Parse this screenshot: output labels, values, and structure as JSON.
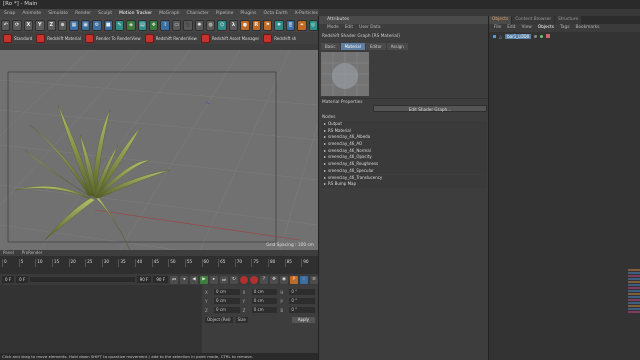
{
  "window": {
    "title": "[Ro *] - Main"
  },
  "menubar": {
    "items": [
      "Snap",
      "Animate",
      "Simulate",
      "Render",
      "Sculpt",
      "Motion Tracker",
      "MoGraph",
      "Character",
      "Pipeline",
      "Plugins",
      "Octa Earth",
      "X-Particles",
      "Redshift",
      "Script",
      "Window",
      "Help"
    ],
    "active": [
      "Motion Tracker",
      "Script",
      "Window"
    ]
  },
  "toolbar": {
    "xyz_labels": [
      "X",
      "Y",
      "Z"
    ],
    "icon_names": [
      "undo-icon",
      "rotate-icon",
      "x-axis-icon",
      "y-axis-icon",
      "z-axis-icon",
      "world-icon",
      "render-region-icon",
      "render-view-icon",
      "render-settings-icon",
      "cube-icon",
      "spline-pen-icon",
      "subdivision-icon",
      "array-icon",
      "cloner-icon",
      "deformer-icon",
      "floor-icon",
      "camera-icon",
      "light-icon",
      "sculpt-icon",
      "xpresso-icon",
      "python-icon",
      "material-icon",
      "redshift-icon",
      "flag-icon",
      "tag-icon",
      "layer-icon",
      "snap-icon",
      "tracker-icon"
    ]
  },
  "rsbar": {
    "buttons": [
      "Standard",
      "Redshift Material",
      "Render To RenderView",
      "Redshift RenderView",
      "Redshift Asset Manager",
      "Redshift sh"
    ]
  },
  "viewport": {
    "grid_spacing": "Grid Spacing : 100 cm",
    "bottom_labels": [
      "Panel",
      "ProRender"
    ]
  },
  "timeline": {
    "ticks": [
      "0",
      "5",
      "10",
      "15",
      "20",
      "25",
      "30",
      "35",
      "40",
      "45",
      "50",
      "55",
      "60",
      "65",
      "70",
      "75",
      "80",
      "85",
      "90"
    ],
    "current_frame": "0 F",
    "start_frame": "0 F",
    "end_frame": "90 F",
    "end_frame2": "90 F"
  },
  "coords": {
    "rows": [
      {
        "label": "X",
        "pos": "0 cm",
        "label2": "X",
        "size": "0 cm",
        "label3": "H",
        "rot": "0 °"
      },
      {
        "label": "Y",
        "pos": "0 cm",
        "label2": "Y",
        "size": "0 cm",
        "label3": "P",
        "rot": "0 °"
      },
      {
        "label": "Z",
        "pos": "0 cm",
        "label2": "Z",
        "size": "0 cm",
        "label3": "B",
        "rot": "0 °"
      }
    ],
    "mode1": "Object (Rel)",
    "mode2": "Size",
    "apply": "Apply"
  },
  "statusbar": {
    "text": "Click and drag to move elements. Hold down SHIFT to quantize movement / add to the selection in point mode, CTRL to remove."
  },
  "attributes": {
    "tab": "Attributes",
    "menu": [
      "Mode",
      "Edit",
      "User Data"
    ],
    "title": "Redshift Shader Graph [RS Material]",
    "subtabs": [
      "Basic",
      "Material",
      "Editor",
      "Assign"
    ],
    "active_subtab": "Material",
    "material_properties": "Material Properties",
    "edit_shader_graph": "Edit Shader Graph...",
    "nodes_header": "Nodes",
    "nodes": [
      "Output",
      "RS Material",
      "sreenclay_46_Albedo",
      "sreenclay_46_AO",
      "sreenclay_46_Normal",
      "sreenclay_46_Opacity",
      "sreenclay_46_Roughness",
      "sreenclay_46_Specular",
      "sreenclay_46_Translucency",
      "RS Bump Map"
    ]
  },
  "objects": {
    "tabs": [
      "Objects",
      "Content Browser",
      "Structure"
    ],
    "active_tab": "Objects",
    "menu": [
      "File",
      "Edit",
      "View",
      "Objects",
      "Tags",
      "Bookmarks"
    ],
    "active_menu": "Objects",
    "object_name": "bar1_LOD0"
  },
  "colors": {
    "grass": "#8c9a4e",
    "grass_dark": "#5e6a2e",
    "redshift_red": "#c8322c",
    "active_tab": "#5e7fa3"
  }
}
